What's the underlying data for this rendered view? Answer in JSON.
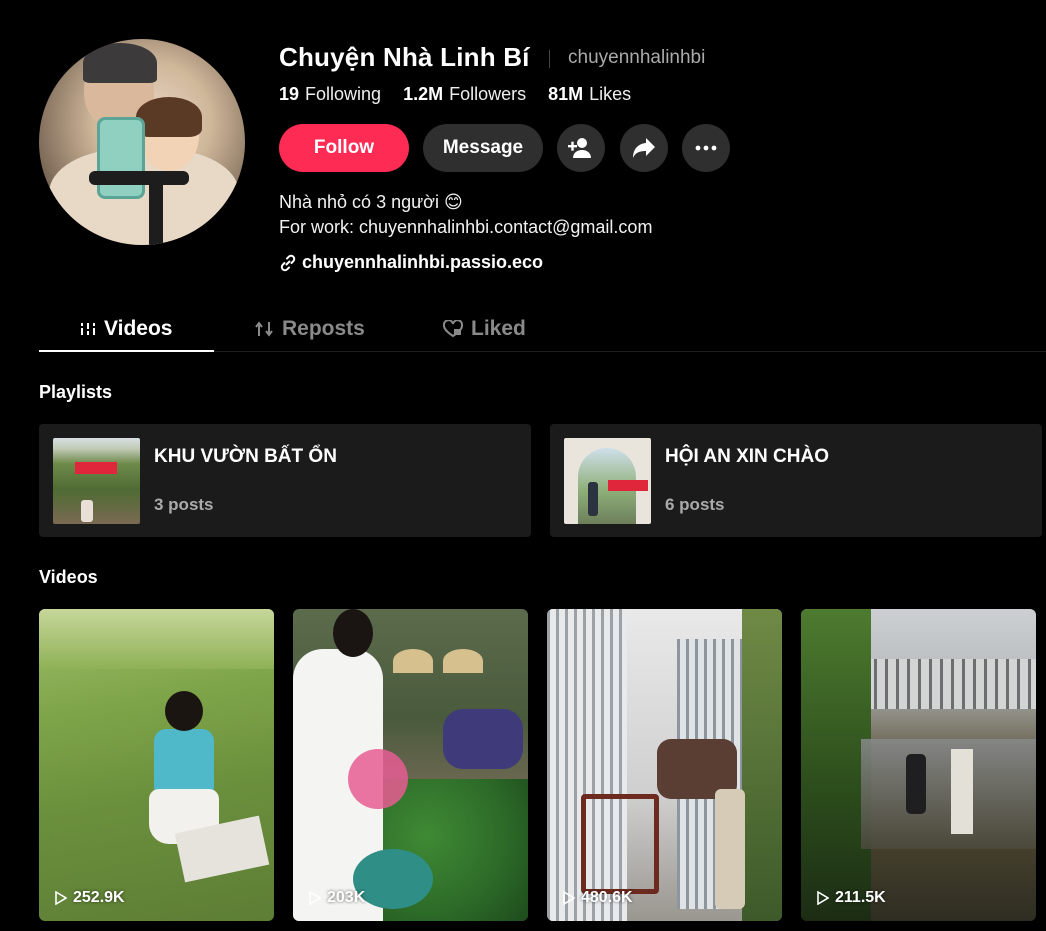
{
  "profile": {
    "name": "Chuyện Nhà Linh Bí",
    "handle": "chuyennhalinhbi",
    "stats": [
      {
        "value": "19",
        "label": "Following"
      },
      {
        "value": "1.2M",
        "label": "Followers"
      },
      {
        "value": "81M",
        "label": "Likes"
      }
    ],
    "bio_line1": "Nhà nhỏ có 3 người 😊",
    "bio_line2": "For work: chuyennhalinhbi.contact@gmail.com",
    "link": "chuyennhalinhbi.passio.eco"
  },
  "actions": {
    "follow_label": "Follow",
    "message_label": "Message",
    "icons": [
      "add-friend-icon",
      "share-icon",
      "more-icon"
    ]
  },
  "tabs": [
    {
      "label": "Videos",
      "icon": "grid-icon",
      "active": true
    },
    {
      "label": "Reposts",
      "icon": "repost-icon",
      "active": false
    },
    {
      "label": "Liked",
      "icon": "heart-lock-icon",
      "active": false
    }
  ],
  "playlists_title": "Playlists",
  "playlists": [
    {
      "title": "KHU VƯỜN BẤT ỔN",
      "count": "3 posts"
    },
    {
      "title": "HỘI AN XIN CHÀO",
      "count": "6 posts"
    }
  ],
  "videos_title": "Videos",
  "videos": [
    {
      "views": "252.9K"
    },
    {
      "views": "203K"
    },
    {
      "views": "480.6K"
    },
    {
      "views": "211.5K"
    }
  ],
  "colors": {
    "accent": "#fe2c55",
    "background": "#000000",
    "card": "#1b1b1b",
    "button_dark": "#2f2f2f"
  }
}
